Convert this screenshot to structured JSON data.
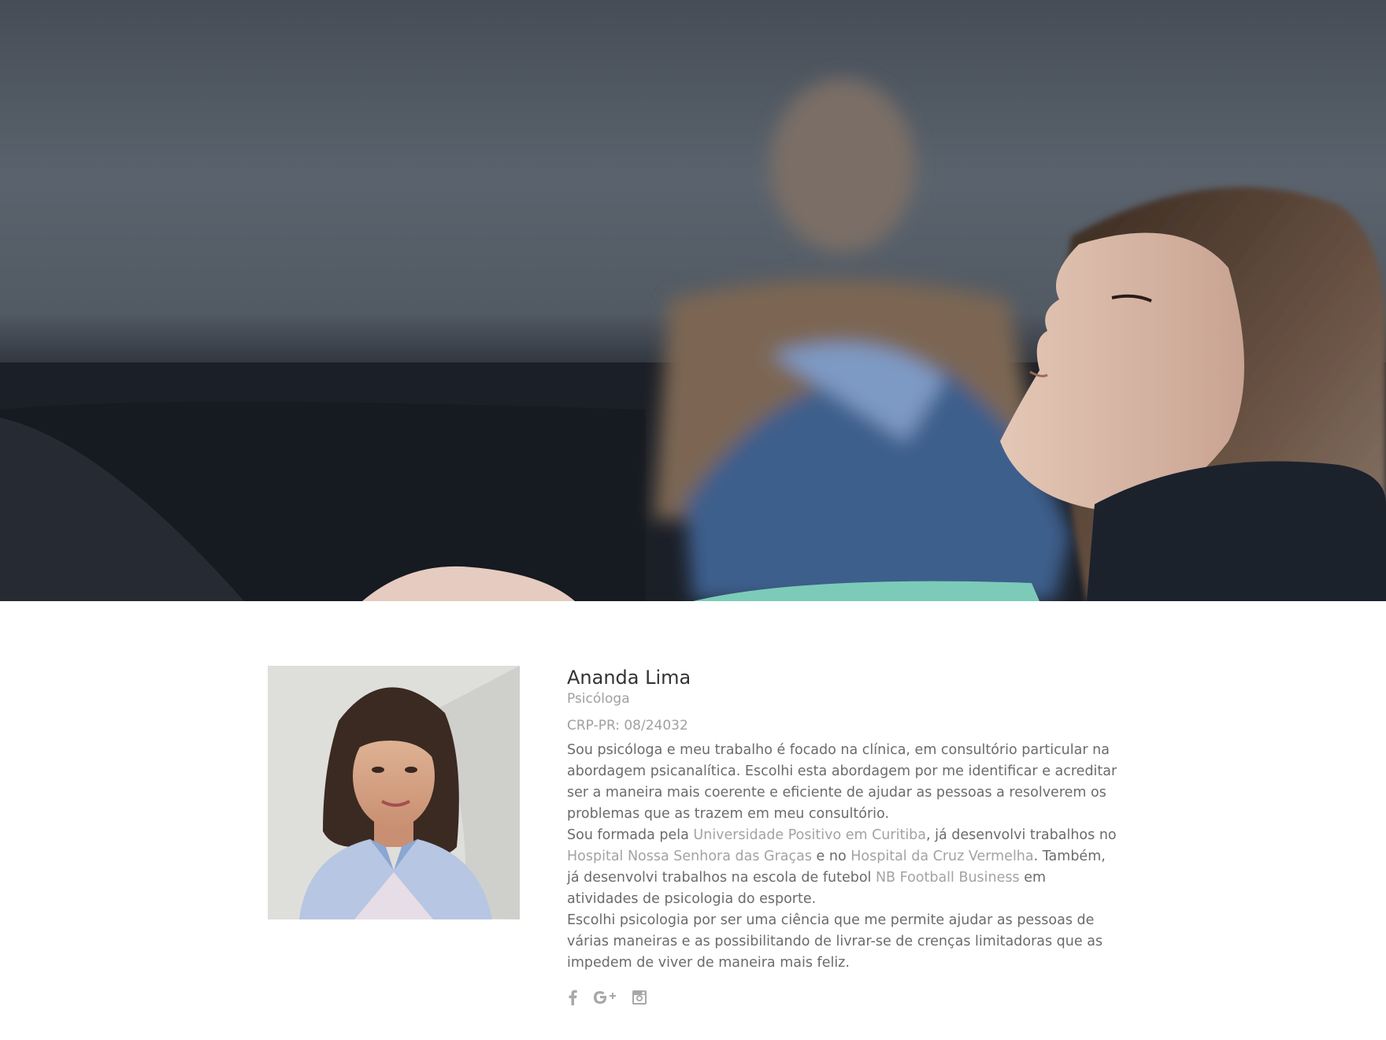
{
  "profile": {
    "name": "Ananda Lima",
    "role": "Psicóloga",
    "crp": "CRP-PR: 08/24032",
    "bio": {
      "p1": "Sou psicóloga e meu trabalho é focado na clínica, em consultório particular na abordagem psicanalítica. Escolhi esta abordagem por me identificar e acreditar ser a maneira mais coerente e eficiente de ajudar as pessoas a resolverem os problemas que as trazem em meu consultório.",
      "p2_a": "Sou formada pela ",
      "p2_link1": "Universidade Positivo em Curitiba",
      "p2_b": ", já desenvolvi trabalhos no ",
      "p2_link2": "Hospital Nossa Senhora das Graças",
      "p2_c": " e no ",
      "p2_link3": "Hospital da Cruz Vermelha",
      "p2_d": ". Também, já desenvolvi trabalhos na escola de futebol ",
      "p2_link4": "NB Football Business",
      "p2_e": " em atividades de psicologia do esporte.",
      "p3": "Escolhi psicologia por ser uma ciência que me permite ajudar as pessoas de várias maneiras e as possibilitando de livrar-se de crenças limitadoras que as impedem de viver de maneira mais feliz."
    },
    "social": [
      {
        "icon": "facebook-icon"
      },
      {
        "icon": "google-plus-icon"
      },
      {
        "icon": "instagram-icon"
      }
    ]
  },
  "colors": {
    "text": "#6b6b6b",
    "muted": "#a0a0a0",
    "heading": "#333333"
  }
}
